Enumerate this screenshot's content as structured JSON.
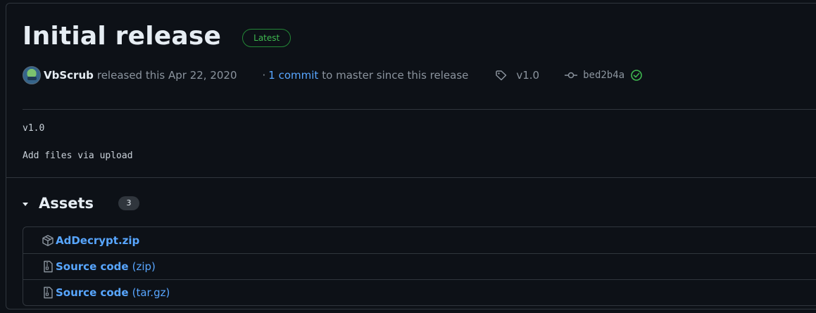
{
  "release": {
    "title": "Initial release",
    "badge": "Latest",
    "author": "VbScrub",
    "released_text": "released this Apr 22, 2020",
    "commit_sep": "·",
    "commit_link": "1 commit",
    "commit_rest": "to master since this release",
    "tag": "v1.0",
    "sha": "bed2b4a",
    "body_version": "v1.0",
    "body_commit": "Add files via upload"
  },
  "assets": {
    "title": "Assets",
    "count": "3",
    "items": [
      {
        "name": "AdDecrypt.zip",
        "suffix": "",
        "icon": "package-icon"
      },
      {
        "name": "Source code",
        "suffix": "(zip)",
        "icon": "file-zip-icon"
      },
      {
        "name": "Source code",
        "suffix": "(tar.gz)",
        "icon": "file-zip-icon"
      }
    ]
  },
  "colors": {
    "background": "#0d1117",
    "border": "#30363d",
    "link": "#58a6ff",
    "success": "#3fb950"
  }
}
